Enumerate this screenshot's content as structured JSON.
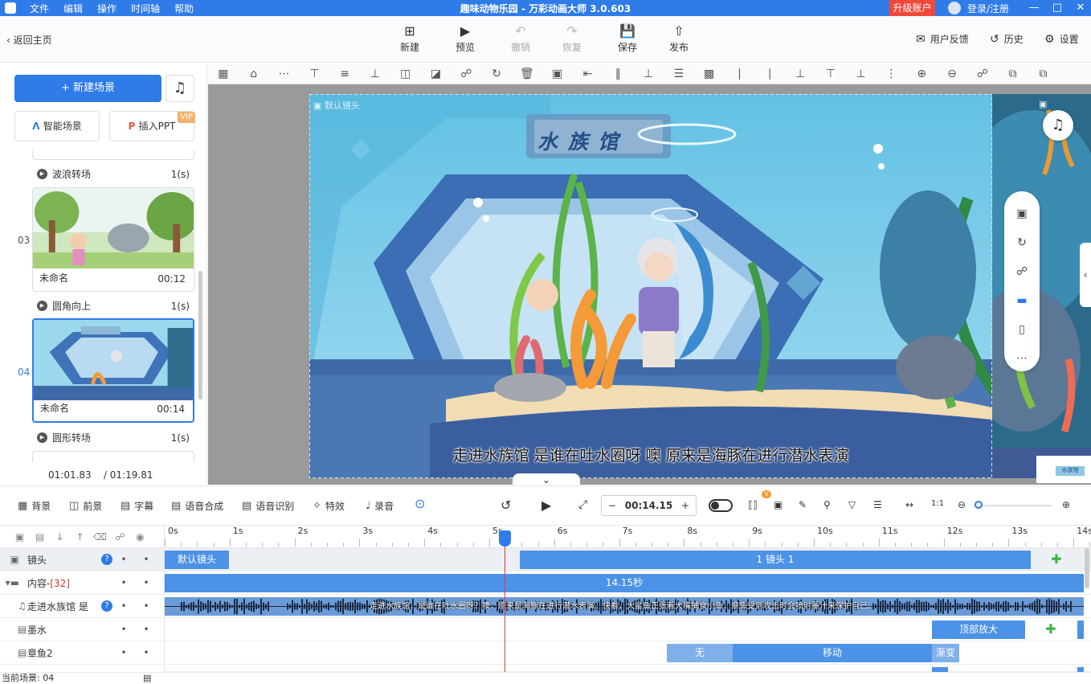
{
  "window": {
    "title": "趣味动物乐园 - 万彩动画大师 3.0.603",
    "menu": [
      "文件",
      "编辑",
      "操作",
      "时间轴",
      "帮助"
    ],
    "upgrade_label": "升级账户",
    "login_label": "登录/注册"
  },
  "toolbar": {
    "back_label": "返回主页",
    "new_label": "新建",
    "preview_label": "预览",
    "undo_label": "撤销",
    "redo_label": "恢复",
    "save_label": "保存",
    "publish_label": "发布",
    "feedback_label": "用户反馈",
    "history_label": "历史",
    "settings_label": "设置"
  },
  "left_panel": {
    "new_scene_label": "新建场景",
    "smart_scene_label": "智能场景",
    "insert_ppt_label": "插入PPT",
    "vip_badge": "VIP",
    "transitions": [
      {
        "name": "波浪转场",
        "duration": "1(s)"
      },
      {
        "name": "圆角向上",
        "duration": "1(s)"
      },
      {
        "name": "圆形转场",
        "duration": "1(s)"
      }
    ],
    "scenes": [
      {
        "index": "03",
        "name": "未命名",
        "time": "00:12"
      },
      {
        "index": "04",
        "name": "未命名",
        "time": "00:14"
      }
    ],
    "current_time": "01:01.83",
    "total_time": "/ 01:19.81"
  },
  "canvas": {
    "camera_label": "默认镜头",
    "poster_text": "水 族 馆",
    "subtitle": "走进水族馆 是谁在吐水圈呀 噢 原来是海豚在进行潜水表演",
    "thumb_label": "水族馆"
  },
  "bottom_toolbar": {
    "background_label": "背景",
    "foreground_label": "前景",
    "caption_label": "字幕",
    "tts_label": "语音合成",
    "asr_label": "语音识别",
    "effects_label": "特效",
    "record_label": "录音",
    "time_value": "00:14.15",
    "minus": "−",
    "plus": "+"
  },
  "timeline": {
    "ticks": [
      "0s",
      "1s",
      "2s",
      "3s",
      "4s",
      "5s",
      "6s",
      "7s",
      "8s",
      "9s",
      "10s",
      "11s",
      "12s",
      "13s",
      "14s"
    ],
    "tracks": [
      {
        "name": "镜头"
      },
      {
        "name": "内容-",
        "count": "[32]"
      },
      {
        "name": "走进水族馆 是"
      },
      {
        "name": "墨水"
      },
      {
        "name": "章鱼2"
      }
    ],
    "clips": {
      "camera_default": "默认镜头",
      "camera_1": "1 镜头 1",
      "content_duration": "14.15秒",
      "audio_text": "走进水族馆，是谁在吐水圈呀？噢，原来是海豚在进行潜水表演。快看，大鲨鱼正张着大嘴捕食小鱼，章鱼受到攻击时会喷射墨汁来保护自己。",
      "ink_clip": "顶部放大",
      "octopus_none": "无",
      "octopus_move": "移动",
      "octopus_fade": "渐变"
    },
    "status": "当前场景: 04"
  }
}
